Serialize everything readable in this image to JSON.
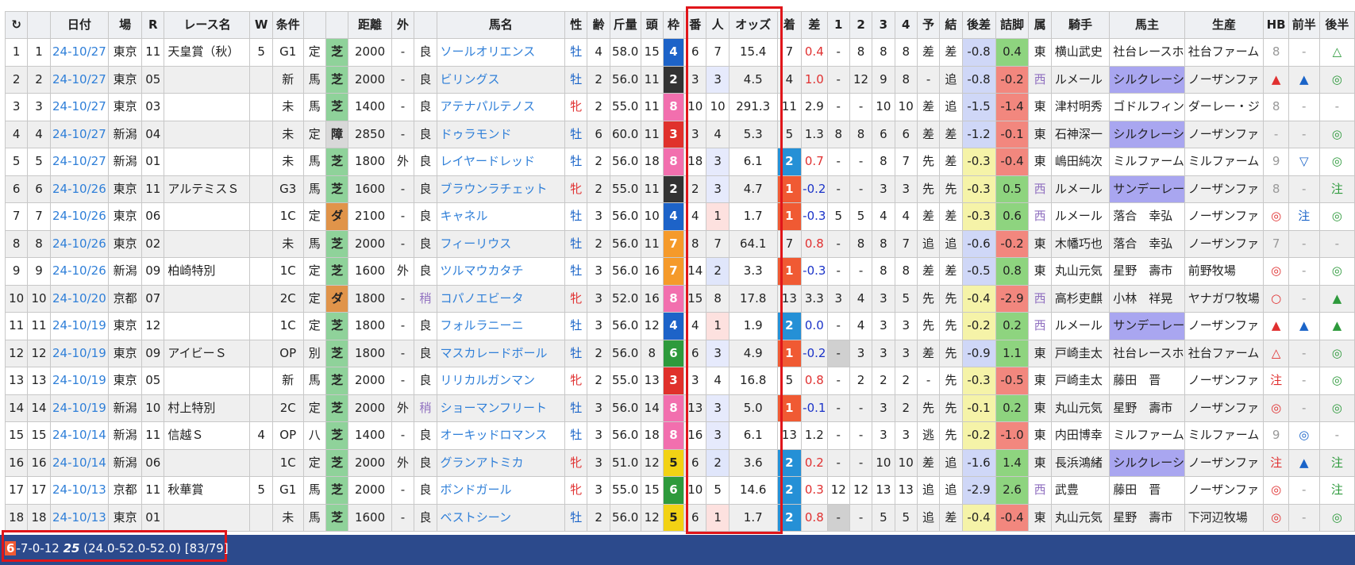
{
  "columns": [
    "",
    "",
    "日付",
    "場",
    "R",
    "レース名",
    "W",
    "条件",
    "",
    "",
    "距離",
    "外",
    "",
    "馬名",
    "性",
    "齢",
    "斤量",
    "頭",
    "枠",
    "番",
    "人",
    "オッズ",
    "着",
    "差",
    "1",
    "2",
    "3",
    "4",
    "予",
    "結",
    "後差",
    "詰脚",
    "属",
    "騎手",
    "馬主",
    "生産",
    "HB",
    "前半",
    "後半"
  ],
  "refresh_icon": "↻",
  "rows": [
    {
      "idx": "1",
      "no": "1",
      "date": "24-10/27",
      "place": "東京",
      "r": "11",
      "race": "天皇賞（秋）",
      "w": "5",
      "cond": "G1",
      "kind": "定",
      "track": "芝",
      "dist": "2000",
      "out": "-",
      "going": "良",
      "horse": "ソールオリエンス",
      "sex": "牡",
      "age": "4",
      "weight": "58.0",
      "heads": "15",
      "waku": "4",
      "ban": "6",
      "pop": "7",
      "odds": "15.4",
      "fin": "7",
      "diff": "0.4",
      "p1": "-",
      "p2": "8",
      "p3": "8",
      "p4": "8",
      "yo": "差",
      "ke": "差",
      "gosa": "-0.8",
      "tsume": "0.4",
      "zoku": "東",
      "jockey": "横山武史",
      "owner": "社台レースホ",
      "breeder": "社台ファーム",
      "hb": "8",
      "mae": "-",
      "ato": "△"
    },
    {
      "idx": "2",
      "no": "2",
      "date": "24-10/27",
      "place": "東京",
      "r": "05",
      "race": "",
      "w": "",
      "cond": "新",
      "kind": "馬",
      "track": "芝",
      "dist": "2000",
      "out": "-",
      "going": "良",
      "horse": "ビリングス",
      "sex": "牡",
      "age": "2",
      "weight": "56.0",
      "heads": "11",
      "waku": "2",
      "ban": "3",
      "pop": "3",
      "odds": "4.5",
      "fin": "4",
      "diff": "1.0",
      "p1": "-",
      "p2": "12",
      "p3": "9",
      "p4": "8",
      "yo": "-",
      "ke": "追",
      "gosa": "-0.8",
      "tsume": "-0.2",
      "zoku": "西",
      "jockey": "ルメール",
      "owner": "シルクレーシ",
      "breeder": "ノーザンファ",
      "hb": "▲",
      "mae": "▲",
      "ato": "◎"
    },
    {
      "idx": "3",
      "no": "3",
      "date": "24-10/27",
      "place": "東京",
      "r": "03",
      "race": "",
      "w": "",
      "cond": "未",
      "kind": "馬",
      "track": "芝",
      "dist": "1400",
      "out": "-",
      "going": "良",
      "horse": "アテナパルテノス",
      "sex": "牝",
      "age": "2",
      "weight": "55.0",
      "heads": "11",
      "waku": "8",
      "ban": "10",
      "pop": "10",
      "odds": "291.3",
      "fin": "11",
      "diff": "2.9",
      "p1": "-",
      "p2": "-",
      "p3": "10",
      "p4": "10",
      "yo": "差",
      "ke": "追",
      "gosa": "-1.5",
      "tsume": "-1.4",
      "zoku": "東",
      "jockey": "津村明秀",
      "owner": "ゴドルフィン",
      "breeder": "ダーレー・ジ",
      "hb": "8",
      "mae": "-",
      "ato": "-"
    },
    {
      "idx": "4",
      "no": "4",
      "date": "24-10/27",
      "place": "新潟",
      "r": "04",
      "race": "",
      "w": "",
      "cond": "未",
      "kind": "定",
      "track": "障",
      "dist": "2850",
      "out": "-",
      "going": "良",
      "horse": "ドゥラモンド",
      "sex": "牡",
      "age": "6",
      "weight": "60.0",
      "heads": "11",
      "waku": "3",
      "ban": "3",
      "pop": "4",
      "odds": "5.3",
      "fin": "5",
      "diff": "1.3",
      "p1": "8",
      "p2": "8",
      "p3": "6",
      "p4": "6",
      "yo": "差",
      "ke": "差",
      "gosa": "-1.2",
      "tsume": "-0.1",
      "zoku": "東",
      "jockey": "石神深一",
      "owner": "シルクレーシ",
      "breeder": "ノーザンファ",
      "hb": "-",
      "mae": "-",
      "ato": "◎"
    },
    {
      "idx": "5",
      "no": "5",
      "date": "24-10/27",
      "place": "新潟",
      "r": "01",
      "race": "",
      "w": "",
      "cond": "未",
      "kind": "馬",
      "track": "芝",
      "dist": "1800",
      "out": "外",
      "going": "良",
      "horse": "レイヤードレッド",
      "sex": "牡",
      "age": "2",
      "weight": "56.0",
      "heads": "18",
      "waku": "8",
      "ban": "18",
      "pop": "3",
      "odds": "6.1",
      "fin": "2",
      "diff": "0.7",
      "p1": "-",
      "p2": "-",
      "p3": "8",
      "p4": "7",
      "yo": "先",
      "ke": "差",
      "gosa": "-0.3",
      "tsume": "-0.4",
      "zoku": "東",
      "jockey": "嶋田純次",
      "owner": "ミルファーム",
      "breeder": "ミルファーム",
      "hb": "9",
      "mae": "▽",
      "ato": "◎"
    },
    {
      "idx": "6",
      "no": "6",
      "date": "24-10/26",
      "place": "東京",
      "r": "11",
      "race": "アルテミスＳ",
      "w": "",
      "cond": "G3",
      "kind": "馬",
      "track": "芝",
      "dist": "1600",
      "out": "-",
      "going": "良",
      "horse": "ブラウンラチェット",
      "sex": "牝",
      "age": "2",
      "weight": "55.0",
      "heads": "11",
      "waku": "2",
      "ban": "2",
      "pop": "3",
      "odds": "4.7",
      "fin": "1",
      "diff": "-0.2",
      "p1": "-",
      "p2": "-",
      "p3": "3",
      "p4": "3",
      "yo": "先",
      "ke": "先",
      "gosa": "-0.3",
      "tsume": "0.5",
      "zoku": "西",
      "jockey": "ルメール",
      "owner": "サンデーレー",
      "breeder": "ノーザンファ",
      "hb": "8",
      "mae": "-",
      "ato": "注"
    },
    {
      "idx": "7",
      "no": "7",
      "date": "24-10/26",
      "place": "東京",
      "r": "06",
      "race": "",
      "w": "",
      "cond": "1C",
      "kind": "定",
      "track": "ダ",
      "dist": "2100",
      "out": "-",
      "going": "良",
      "horse": "キャネル",
      "sex": "牡",
      "age": "3",
      "weight": "56.0",
      "heads": "10",
      "waku": "4",
      "ban": "4",
      "pop": "1",
      "odds": "1.7",
      "fin": "1",
      "diff": "-0.3",
      "p1": "5",
      "p2": "5",
      "p3": "4",
      "p4": "4",
      "yo": "差",
      "ke": "差",
      "gosa": "-0.3",
      "tsume": "0.6",
      "zoku": "西",
      "jockey": "ルメール",
      "owner": "落合　幸弘",
      "breeder": "ノーザンファ",
      "hb": "◎",
      "mae": "注",
      "ato": "◎"
    },
    {
      "idx": "8",
      "no": "8",
      "date": "24-10/26",
      "place": "東京",
      "r": "02",
      "race": "",
      "w": "",
      "cond": "未",
      "kind": "馬",
      "track": "芝",
      "dist": "2000",
      "out": "-",
      "going": "良",
      "horse": "フィーリウス",
      "sex": "牡",
      "age": "2",
      "weight": "56.0",
      "heads": "11",
      "waku": "7",
      "ban": "8",
      "pop": "7",
      "odds": "64.1",
      "fin": "7",
      "diff": "0.8",
      "p1": "-",
      "p2": "8",
      "p3": "8",
      "p4": "7",
      "yo": "追",
      "ke": "追",
      "gosa": "-0.6",
      "tsume": "-0.2",
      "zoku": "東",
      "jockey": "木幡巧也",
      "owner": "落合　幸弘",
      "breeder": "ノーザンファ",
      "hb": "7",
      "mae": "-",
      "ato": "-"
    },
    {
      "idx": "9",
      "no": "9",
      "date": "24-10/26",
      "place": "新潟",
      "r": "09",
      "race": "柏崎特別",
      "w": "",
      "cond": "1C",
      "kind": "定",
      "track": "芝",
      "dist": "1600",
      "out": "外",
      "going": "良",
      "horse": "ツルマウカタチ",
      "sex": "牡",
      "age": "3",
      "weight": "56.0",
      "heads": "16",
      "waku": "7",
      "ban": "14",
      "pop": "2",
      "odds": "3.3",
      "fin": "1",
      "diff": "-0.3",
      "p1": "-",
      "p2": "-",
      "p3": "8",
      "p4": "8",
      "yo": "差",
      "ke": "差",
      "gosa": "-0.5",
      "tsume": "0.8",
      "zoku": "東",
      "jockey": "丸山元気",
      "owner": "星野　壽市",
      "breeder": "前野牧場",
      "hb": "◎",
      "mae": "-",
      "ato": "◎"
    },
    {
      "idx": "10",
      "no": "10",
      "date": "24-10/20",
      "place": "京都",
      "r": "07",
      "race": "",
      "w": "",
      "cond": "2C",
      "kind": "定",
      "track": "ダ",
      "dist": "1800",
      "out": "-",
      "going": "稍",
      "horse": "コパノエビータ",
      "sex": "牝",
      "age": "3",
      "weight": "52.0",
      "heads": "16",
      "waku": "8",
      "ban": "15",
      "pop": "8",
      "odds": "17.8",
      "fin": "13",
      "diff": "3.3",
      "p1": "3",
      "p2": "4",
      "p3": "3",
      "p4": "5",
      "yo": "先",
      "ke": "先",
      "gosa": "-0.4",
      "tsume": "-2.9",
      "zoku": "西",
      "jockey": "高杉吏麒",
      "owner": "小林　祥晃",
      "breeder": "ヤナガワ牧場",
      "hb": "○",
      "mae": "-",
      "ato": "▲"
    },
    {
      "idx": "11",
      "no": "11",
      "date": "24-10/19",
      "place": "東京",
      "r": "12",
      "race": "",
      "w": "",
      "cond": "1C",
      "kind": "定",
      "track": "芝",
      "dist": "1800",
      "out": "-",
      "going": "良",
      "horse": "フォルラニーニ",
      "sex": "牡",
      "age": "3",
      "weight": "56.0",
      "heads": "12",
      "waku": "4",
      "ban": "4",
      "pop": "1",
      "odds": "1.9",
      "fin": "2",
      "diff": "0.0",
      "p1": "-",
      "p2": "4",
      "p3": "3",
      "p4": "3",
      "yo": "先",
      "ke": "先",
      "gosa": "-0.2",
      "tsume": "0.2",
      "zoku": "西",
      "jockey": "ルメール",
      "owner": "サンデーレー",
      "breeder": "ノーザンファ",
      "hb": "▲",
      "mae": "▲",
      "ato": "▲"
    },
    {
      "idx": "12",
      "no": "12",
      "date": "24-10/19",
      "place": "東京",
      "r": "09",
      "race": "アイビーＳ",
      "w": "",
      "cond": "OP",
      "kind": "別",
      "track": "芝",
      "dist": "1800",
      "out": "-",
      "going": "良",
      "horse": "マスカレードボール",
      "sex": "牡",
      "age": "2",
      "weight": "56.0",
      "heads": "8",
      "waku": "6",
      "ban": "6",
      "pop": "3",
      "odds": "4.9",
      "fin": "1",
      "diff": "-0.2",
      "p1": "-",
      "p2": "3",
      "p3": "3",
      "p4": "3",
      "yo": "差",
      "ke": "先",
      "gosa": "-0.9",
      "tsume": "1.1",
      "zoku": "東",
      "jockey": "戸崎圭太",
      "owner": "社台レースホ",
      "breeder": "社台ファーム",
      "hb": "△",
      "mae": "-",
      "ato": "◎"
    },
    {
      "idx": "13",
      "no": "13",
      "date": "24-10/19",
      "place": "東京",
      "r": "05",
      "race": "",
      "w": "",
      "cond": "新",
      "kind": "馬",
      "track": "芝",
      "dist": "2000",
      "out": "-",
      "going": "良",
      "horse": "リリカルガンマン",
      "sex": "牝",
      "age": "2",
      "weight": "55.0",
      "heads": "13",
      "waku": "3",
      "ban": "3",
      "pop": "4",
      "odds": "16.8",
      "fin": "5",
      "diff": "0.8",
      "p1": "-",
      "p2": "2",
      "p3": "2",
      "p4": "2",
      "yo": "-",
      "ke": "先",
      "gosa": "-0.3",
      "tsume": "-0.5",
      "zoku": "東",
      "jockey": "戸崎圭太",
      "owner": "藤田　晋",
      "breeder": "ノーザンファ",
      "hb": "注",
      "mae": "-",
      "ato": "◎"
    },
    {
      "idx": "14",
      "no": "14",
      "date": "24-10/19",
      "place": "新潟",
      "r": "10",
      "race": "村上特別",
      "w": "",
      "cond": "2C",
      "kind": "定",
      "track": "芝",
      "dist": "2000",
      "out": "外",
      "going": "稍",
      "horse": "ショーマンフリート",
      "sex": "牡",
      "age": "3",
      "weight": "56.0",
      "heads": "14",
      "waku": "8",
      "ban": "13",
      "pop": "3",
      "odds": "5.0",
      "fin": "1",
      "diff": "-0.1",
      "p1": "-",
      "p2": "-",
      "p3": "3",
      "p4": "2",
      "yo": "先",
      "ke": "先",
      "gosa": "-0.1",
      "tsume": "0.2",
      "zoku": "東",
      "jockey": "丸山元気",
      "owner": "星野　壽市",
      "breeder": "ノーザンファ",
      "hb": "◎",
      "mae": "-",
      "ato": "◎"
    },
    {
      "idx": "15",
      "no": "15",
      "date": "24-10/14",
      "place": "新潟",
      "r": "11",
      "race": "信越Ｓ",
      "w": "4",
      "cond": "OP",
      "kind": "八",
      "track": "芝",
      "dist": "1400",
      "out": "-",
      "going": "良",
      "horse": "オーキッドロマンス",
      "sex": "牡",
      "age": "3",
      "weight": "56.0",
      "heads": "18",
      "waku": "8",
      "ban": "16",
      "pop": "3",
      "odds": "6.1",
      "fin": "13",
      "diff": "1.2",
      "p1": "-",
      "p2": "-",
      "p3": "3",
      "p4": "3",
      "yo": "逃",
      "ke": "先",
      "gosa": "-0.2",
      "tsume": "-1.0",
      "zoku": "東",
      "jockey": "内田博幸",
      "owner": "ミルファーム",
      "breeder": "ミルファーム",
      "hb": "9",
      "mae": "◎",
      "ato": "-"
    },
    {
      "idx": "16",
      "no": "16",
      "date": "24-10/14",
      "place": "新潟",
      "r": "06",
      "race": "",
      "w": "",
      "cond": "1C",
      "kind": "定",
      "track": "芝",
      "dist": "2000",
      "out": "外",
      "going": "良",
      "horse": "グランアトミカ",
      "sex": "牝",
      "age": "3",
      "weight": "51.0",
      "heads": "12",
      "waku": "5",
      "ban": "6",
      "pop": "2",
      "odds": "3.6",
      "fin": "2",
      "diff": "0.2",
      "p1": "-",
      "p2": "-",
      "p3": "10",
      "p4": "10",
      "yo": "差",
      "ke": "追",
      "gosa": "-1.6",
      "tsume": "1.4",
      "zoku": "東",
      "jockey": "長浜鴻緒",
      "owner": "シルクレーシ",
      "breeder": "ノーザンファ",
      "hb": "注",
      "mae": "▲",
      "ato": "注"
    },
    {
      "idx": "17",
      "no": "17",
      "date": "24-10/13",
      "place": "京都",
      "r": "11",
      "race": "秋華賞",
      "w": "5",
      "cond": "G1",
      "kind": "馬",
      "track": "芝",
      "dist": "2000",
      "out": "-",
      "going": "良",
      "horse": "ボンドガール",
      "sex": "牝",
      "age": "3",
      "weight": "55.0",
      "heads": "15",
      "waku": "6",
      "ban": "10",
      "pop": "5",
      "odds": "14.6",
      "fin": "2",
      "diff": "0.3",
      "p1": "12",
      "p2": "12",
      "p3": "13",
      "p4": "13",
      "yo": "追",
      "ke": "追",
      "gosa": "-2.9",
      "tsume": "2.6",
      "zoku": "西",
      "jockey": "武豊",
      "owner": "藤田　晋",
      "breeder": "ノーザンファ",
      "hb": "◎",
      "mae": "-",
      "ato": "注"
    },
    {
      "idx": "18",
      "no": "18",
      "date": "24-10/13",
      "place": "東京",
      "r": "01",
      "race": "",
      "w": "",
      "cond": "未",
      "kind": "馬",
      "track": "芝",
      "dist": "1600",
      "out": "-",
      "going": "良",
      "horse": "ベストシーン",
      "sex": "牡",
      "age": "2",
      "weight": "56.0",
      "heads": "12",
      "waku": "5",
      "ban": "6",
      "pop": "1",
      "odds": "1.7",
      "fin": "2",
      "diff": "0.8",
      "p1": "-",
      "p2": "-",
      "p3": "5",
      "p4": "5",
      "yo": "追",
      "ke": "差",
      "gosa": "-0.4",
      "tsume": "-0.4",
      "zoku": "東",
      "jockey": "丸山元気",
      "owner": "星野　壽市",
      "breeder": "下河辺牧場",
      "hb": "◎",
      "mae": "-",
      "ato": "◎"
    }
  ],
  "summary": {
    "lead": "6",
    "rest": "-7-0-12 ",
    "bold": "25",
    "tail": " (24.0-52.0-52.0) [83/79]"
  }
}
